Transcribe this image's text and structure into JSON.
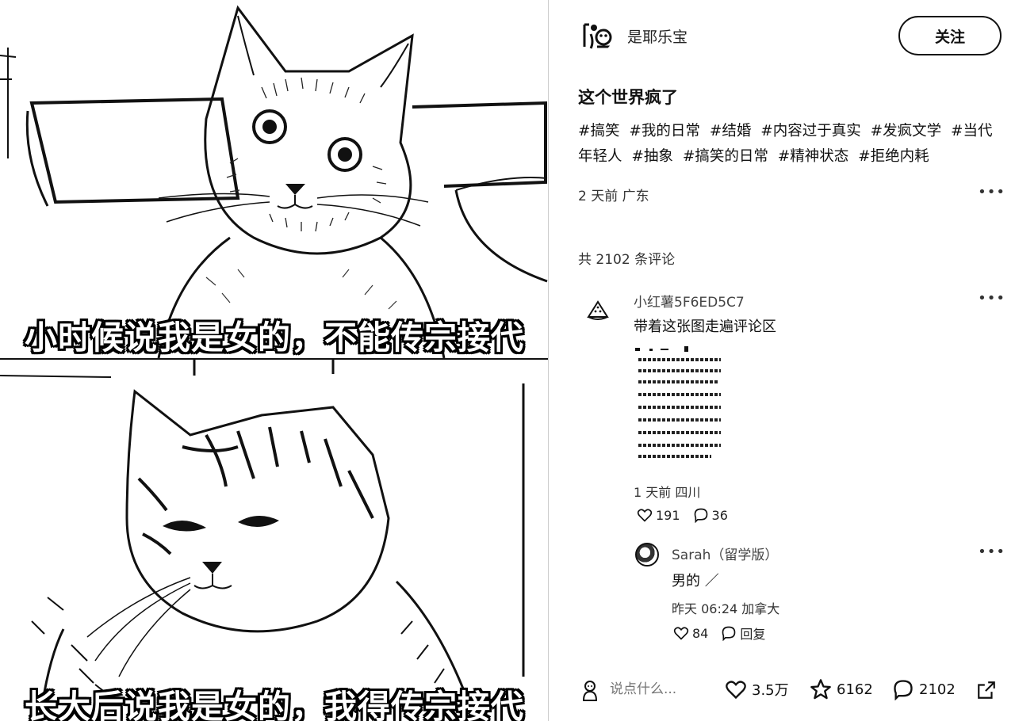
{
  "image": {
    "top_caption": "小时候说我是女的，不能传宗接代",
    "bottom_caption": "长大后说我是女的，我得传宗接代"
  },
  "author": {
    "name": "是耶乐宝",
    "follow_label": "关注"
  },
  "post": {
    "title": "这个世界疯了",
    "tags": [
      "#搞笑",
      "#我的日常",
      "#结婚",
      "#内容过于真实",
      "#发疯文学",
      "#当代年轻人",
      "#抽象",
      "#搞笑的日常",
      "#精神状态",
      "#拒绝内耗"
    ],
    "meta": "2 天前 广东"
  },
  "comments": {
    "count_label": "共 2102 条评论",
    "items": [
      {
        "user": "小红薯5F6ED5C7",
        "text": "带着这张图走遍评论区",
        "meta": "1 天前 四川",
        "likes": "191",
        "replies": "36",
        "reply": {
          "user": "Sarah（留学版）",
          "text": "男的 ／",
          "meta": "昨天 06:24 加拿大",
          "likes": "84",
          "reply_label": "回复"
        }
      }
    ]
  },
  "bottom_bar": {
    "input_placeholder": "说点什么...",
    "likes": "3.5万",
    "stars": "6162",
    "comments": "2102"
  },
  "icons": {
    "more": "more-icon",
    "heart": "heart-icon",
    "star": "star-icon",
    "comment": "comment-icon",
    "share": "share-icon"
  }
}
